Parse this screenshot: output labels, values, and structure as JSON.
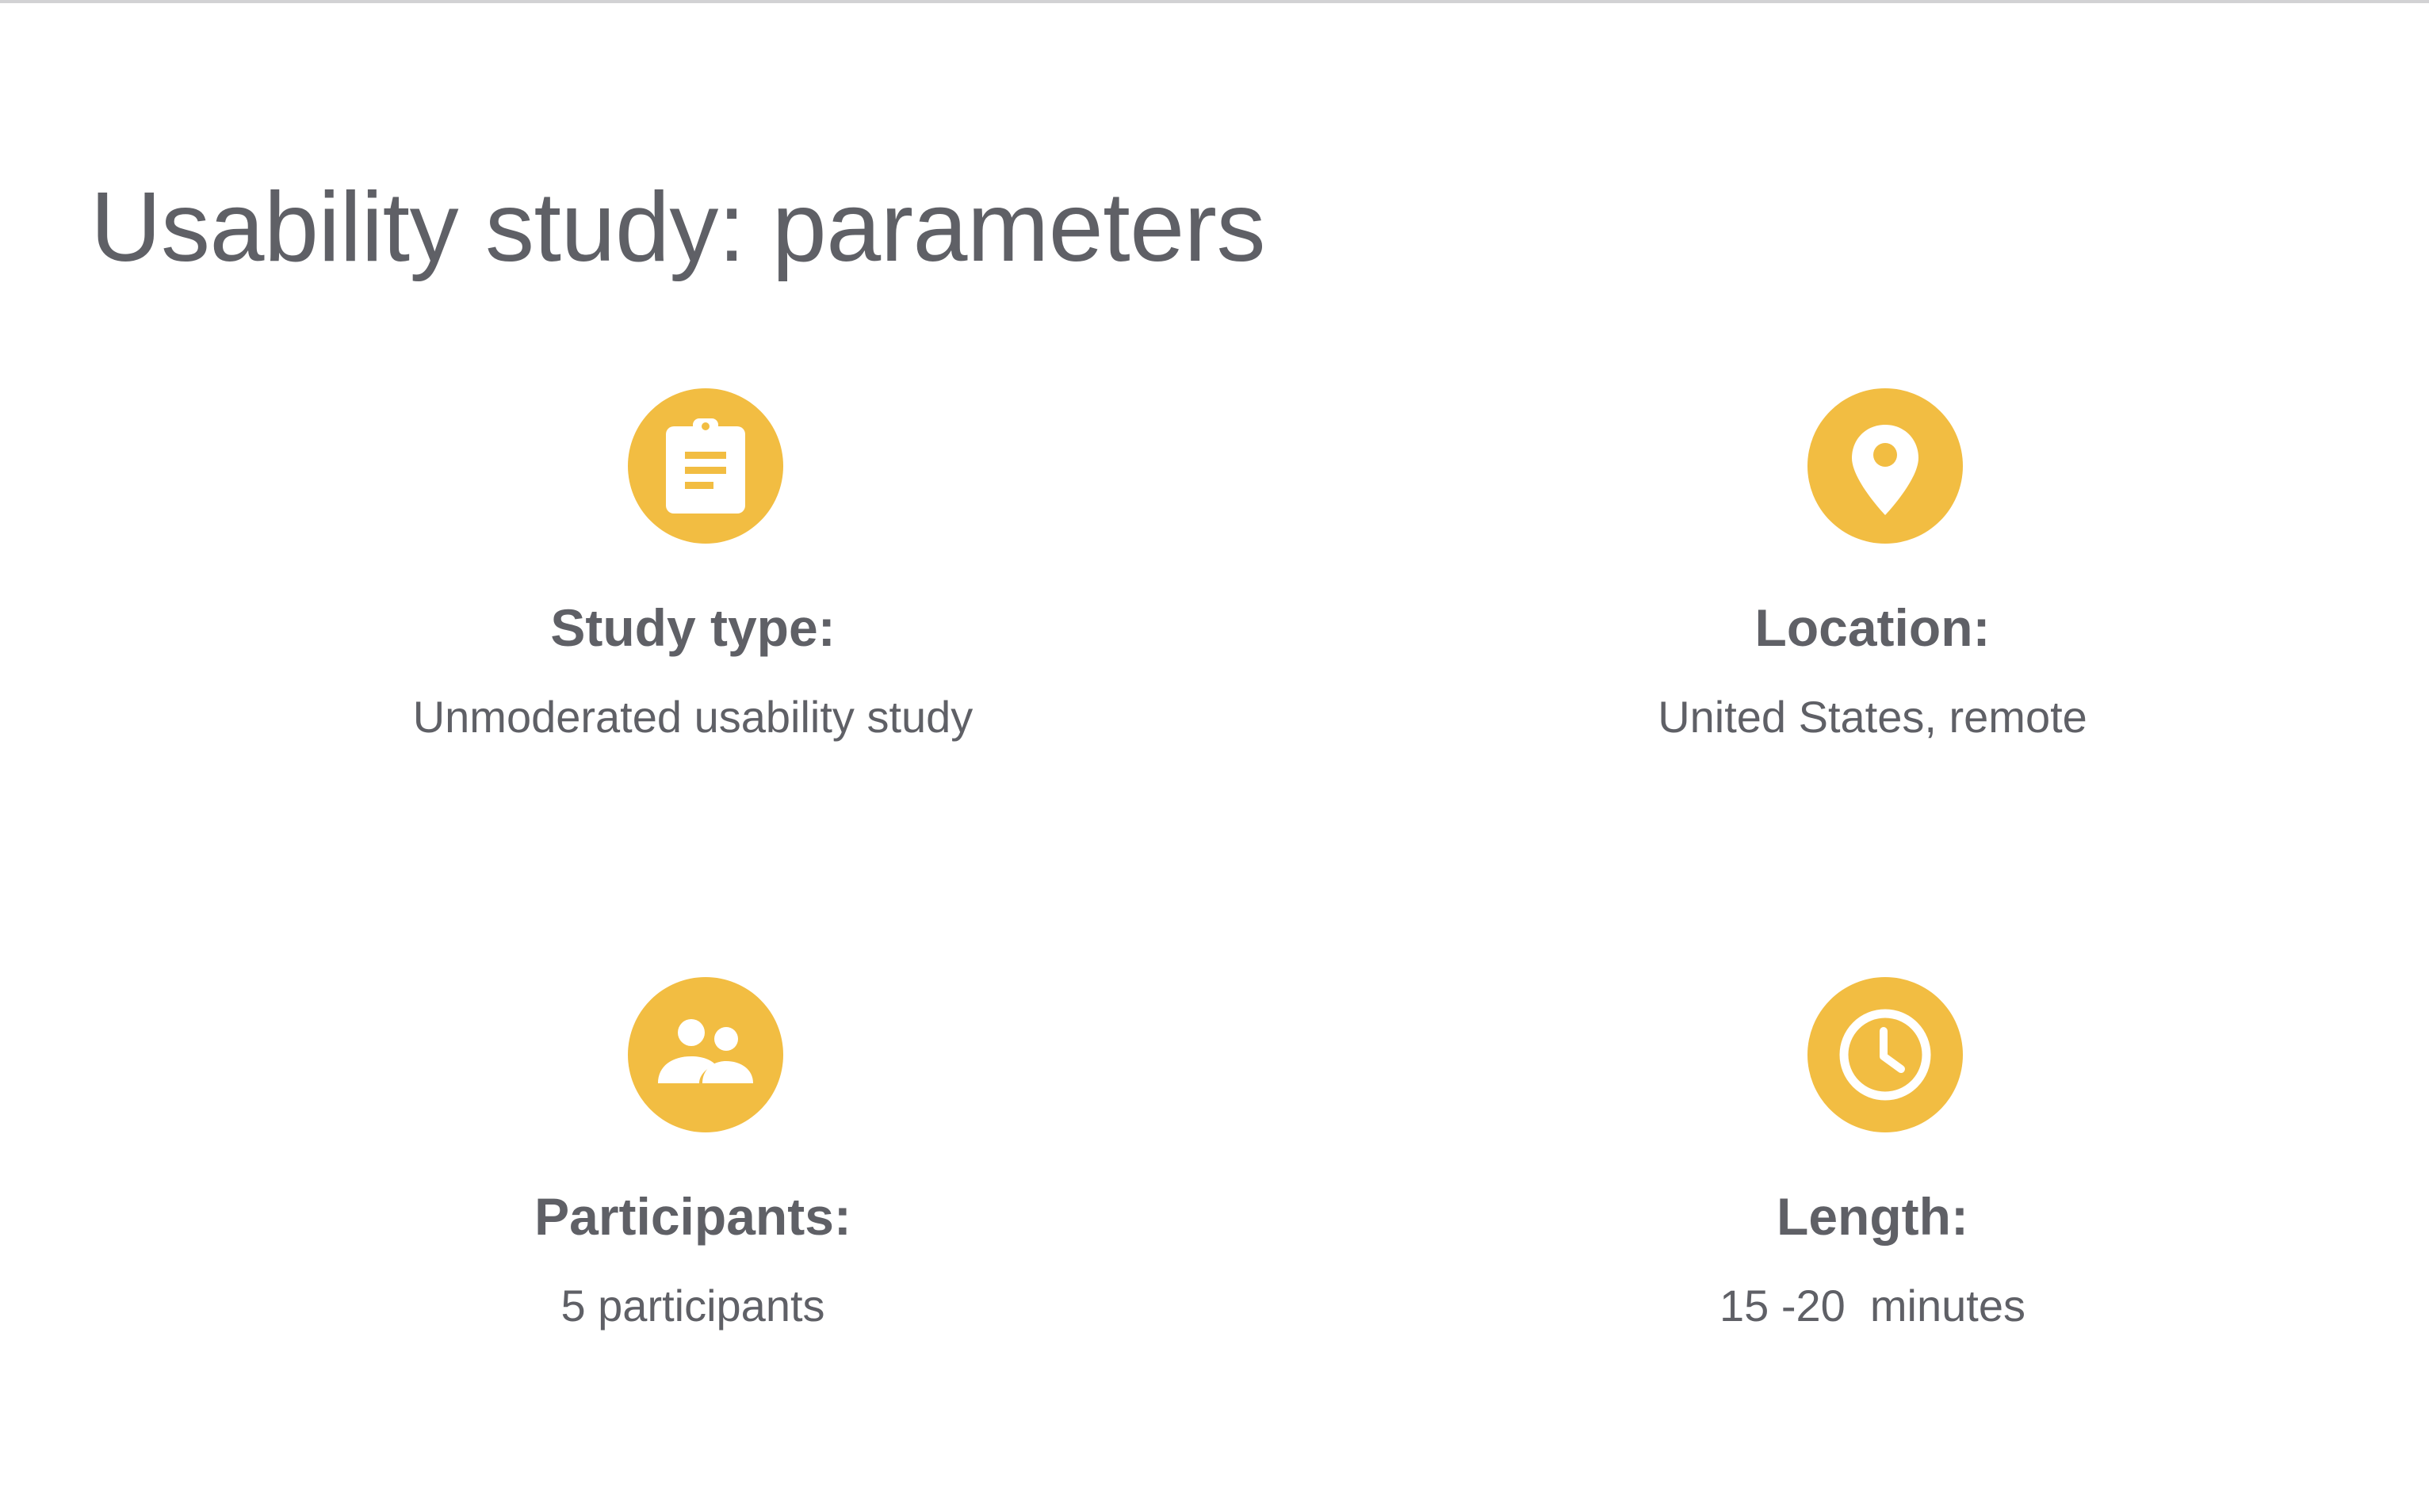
{
  "title": "Usability study: parameters",
  "colors": {
    "accent": "#f2bd42",
    "text": "#5f6066",
    "background": "#ffffff"
  },
  "parameters": [
    {
      "label": "Study type:",
      "value": "Unmoderated usability study",
      "icon": "clipboard-icon"
    },
    {
      "label": "Location:",
      "value": "United States, remote",
      "icon": "location-pin-icon"
    },
    {
      "label": "Participants:",
      "value": "5 participants",
      "icon": "people-icon"
    },
    {
      "label": "Length:",
      "value": "15 -20  minutes",
      "icon": "clock-icon"
    }
  ]
}
